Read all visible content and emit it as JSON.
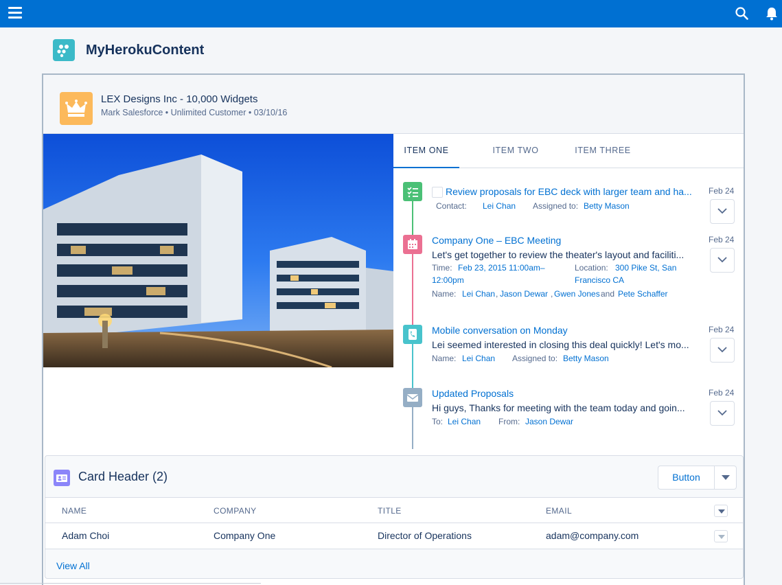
{
  "topbar": {
    "menu_icon": "hamburger-icon",
    "search_icon": "search-icon",
    "notification_icon": "bell-icon",
    "color": "#0070d2"
  },
  "app": {
    "title": "MyHerokuContent",
    "logo_icon": "heroku-logo-icon"
  },
  "record": {
    "icon": "crown-icon",
    "title": "LEX Designs Inc - 10,000 Widgets",
    "subtitle": "Mark Salesforce • Unlimited Customer • 03/10/16"
  },
  "image": {
    "subject": "building-photo"
  },
  "tabs": [
    {
      "label": "ITEM ONE",
      "active": true
    },
    {
      "label": "ITEM TWO",
      "active": false
    },
    {
      "label": "ITEM THREE",
      "active": false
    }
  ],
  "timeline": [
    {
      "type": "task",
      "icon": "task-icon",
      "color": "#4bc076",
      "title": "Review proposals for EBC deck with larger team and ha...",
      "date": "Feb 24",
      "meta": [
        {
          "label": "Contact:",
          "value": "Lei Chan"
        },
        {
          "label": "Assigned to:",
          "value": "Betty Mason"
        }
      ]
    },
    {
      "type": "event",
      "icon": "calendar-icon",
      "color": "#eb7092",
      "title": "Company One – EBC Meeting",
      "description": "Let's get together to review the theater's layout and faciliti...",
      "date": "Feb 24",
      "time_label": "Time:",
      "time_line1": "Feb 23, 2015 11:00am–",
      "time_line2": "12:00pm",
      "location_label": "Location:",
      "location_line1": "300 Pike St, San",
      "location_line2": "Francisco CA",
      "name_label": "Name:",
      "names": [
        "Lei Chan",
        "Jason Dewar",
        "Gwen Jones",
        "Pete Schaffer"
      ],
      "separator": ",",
      "and_word": "and"
    },
    {
      "type": "call",
      "icon": "phone-icon",
      "color": "#48c3cc",
      "title": "Mobile conversation on Monday",
      "description": "Lei seemed interested in closing this deal quickly! Let's mo...",
      "date": "Feb 24",
      "meta": [
        {
          "label": "Name:",
          "value": "Lei Chan"
        },
        {
          "label": "Assigned to:",
          "value": "Betty Mason"
        }
      ]
    },
    {
      "type": "email",
      "icon": "email-icon",
      "color": "#95aec5",
      "title": "Updated Proposals",
      "description": "Hi guys, Thanks for meeting with the team today and goin...",
      "date": "Feb 24",
      "meta": [
        {
          "label": "To:",
          "value": "Lei Chan"
        },
        {
          "label": "From:",
          "value": "Jason Dewar"
        }
      ]
    }
  ],
  "card": {
    "icon": "contact-card-icon",
    "title": "Card Header (2)",
    "button_label": "Button",
    "columns": [
      "NAME",
      "COMPANY",
      "TITLE",
      "EMAIL"
    ],
    "rows": [
      {
        "name": "Adam Choi",
        "company": "Company One",
        "title": "Director of Operations",
        "email": "adam@company.com"
      }
    ],
    "view_all": "View All"
  }
}
